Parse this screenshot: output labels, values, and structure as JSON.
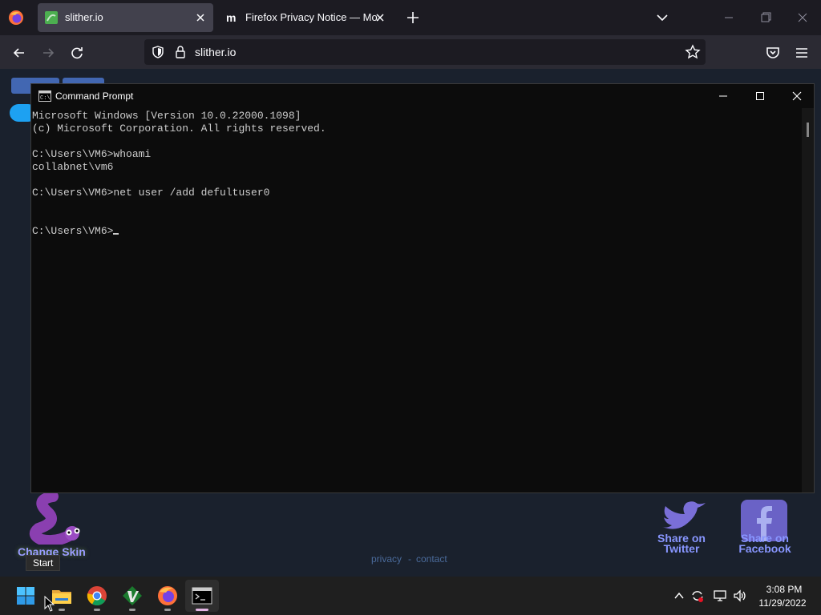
{
  "browser": {
    "tabs": [
      {
        "title": "slither.io",
        "active": true
      },
      {
        "title": "Firefox Privacy Notice — Mozilla",
        "active": false
      }
    ],
    "url": "slither.io"
  },
  "page": {
    "change_skin": "Change Skin",
    "privacy": "privacy",
    "separator": "-",
    "contact": "contact",
    "share_twitter": "Share on Twitter",
    "share_facebook": "Share on Facebook"
  },
  "cmd": {
    "title": "Command Prompt",
    "lines": [
      "Microsoft Windows [Version 10.0.22000.1098]",
      "(c) Microsoft Corporation. All rights reserved.",
      "",
      "C:\\Users\\VM6>whoami",
      "collabnet\\vm6",
      "",
      "C:\\Users\\VM6>net user /add defultuser0",
      "",
      ""
    ],
    "prompt": "C:\\Users\\VM6>"
  },
  "taskbar": {
    "tooltip": "Start",
    "time": "3:08 PM",
    "date": "11/29/2022",
    "pinned": [
      "start-icon",
      "file-explorer-icon",
      "chrome-icon",
      "vim-icon",
      "firefox-icon",
      "terminal-icon"
    ]
  },
  "colors": {
    "cmd_bg": "#0c0c0c",
    "cmd_text": "#cccccc",
    "browser_bg": "#1c1b22",
    "taskbar_bg": "#1f1f1f"
  }
}
